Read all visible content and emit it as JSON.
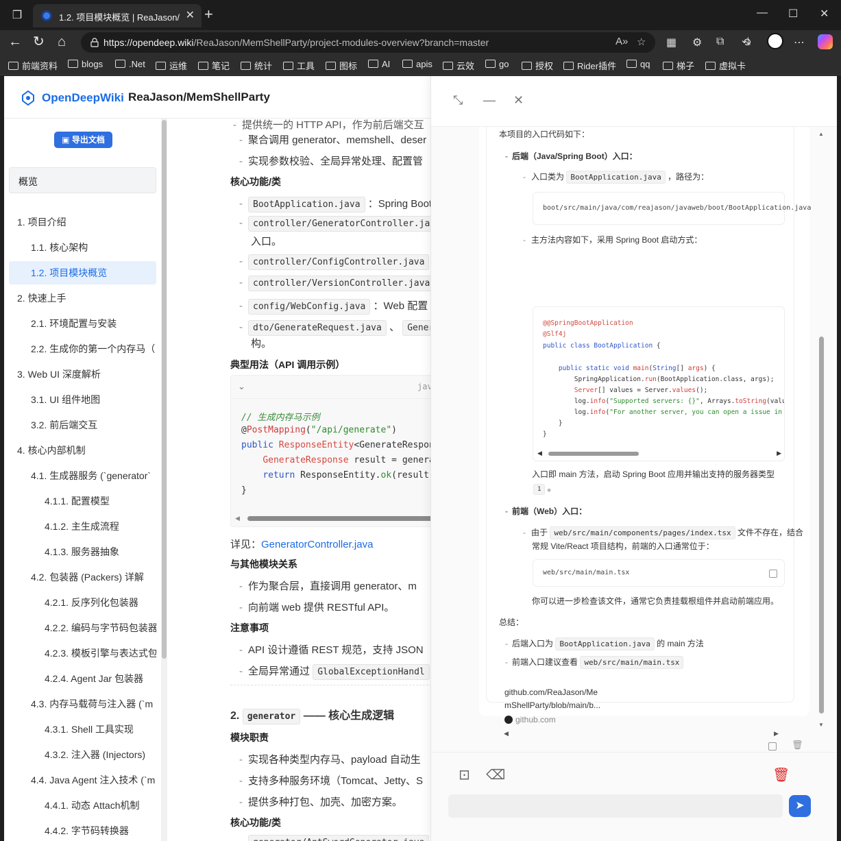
{
  "browser": {
    "tab_title": "1.2. 项目模块概览 | ReaJason/MemShellParty",
    "url_host": "https://opendeep.wiki",
    "url_path": "/ReaJason/MemShellParty/project-modules-overview?branch=master",
    "bookmarks": [
      "前端资料",
      "blogs",
      ".Net",
      "运维",
      "笔记",
      "统计",
      "工具",
      "图标",
      "AI",
      "apis",
      "云效",
      "go",
      "授权",
      "Rider插件",
      "qq",
      "梯子",
      "虚拟卡"
    ]
  },
  "site": {
    "brand": "OpenDeepWiki",
    "repo": "ReaJason/MemShellParty"
  },
  "sidebar": {
    "export_label": "导出文档",
    "overview_label": "概览",
    "items": [
      {
        "label": "1. 项目介绍",
        "level": 0,
        "active": false
      },
      {
        "label": "1.1. 核心架构",
        "level": 1,
        "active": false
      },
      {
        "label": "1.2. 项目模块概览",
        "level": 1,
        "active": true
      },
      {
        "label": "2. 快速上手",
        "level": 0,
        "active": false
      },
      {
        "label": "2.1. 环境配置与安装",
        "level": 1,
        "active": false
      },
      {
        "label": "2.2. 生成你的第一个内存马（",
        "level": 1,
        "active": false
      },
      {
        "label": "3. Web UI 深度解析",
        "level": 0,
        "active": false
      },
      {
        "label": "3.1. UI 组件地图",
        "level": 1,
        "active": false
      },
      {
        "label": "3.2. 前后端交互",
        "level": 1,
        "active": false
      },
      {
        "label": "4. 核心内部机制",
        "level": 0,
        "active": false
      },
      {
        "label": "4.1. 生成器服务 (`generator`",
        "level": 1,
        "active": false
      },
      {
        "label": "4.1.1. 配置模型",
        "level": 2,
        "active": false
      },
      {
        "label": "4.1.2. 主生成流程",
        "level": 2,
        "active": false
      },
      {
        "label": "4.1.3. 服务器抽象",
        "level": 2,
        "active": false
      },
      {
        "label": "4.2. 包装器 (Packers) 详解",
        "level": 1,
        "active": false
      },
      {
        "label": "4.2.1. 反序列化包装器",
        "level": 2,
        "active": false
      },
      {
        "label": "4.2.2. 编码与字节码包装器",
        "level": 2,
        "active": false
      },
      {
        "label": "4.2.3. 模板引擎与表达式包",
        "level": 2,
        "active": false
      },
      {
        "label": "4.2.4. Agent Jar 包装器",
        "level": 2,
        "active": false
      },
      {
        "label": "4.3. 内存马载荷与注入器 (`m",
        "level": 1,
        "active": false
      },
      {
        "label": "4.3.1. Shell 工具实现",
        "level": 2,
        "active": false
      },
      {
        "label": "4.3.2. 注入器 (Injectors)",
        "level": 2,
        "active": false
      },
      {
        "label": "4.4. Java Agent 注入技术 (`m",
        "level": 1,
        "active": false
      },
      {
        "label": "4.4.1. 动态 Attach机制",
        "level": 2,
        "active": false
      },
      {
        "label": "4.4.2. 字节码转换器",
        "level": 2,
        "active": false
      }
    ]
  },
  "doc": {
    "line_top": "提供统一的 HTTP API，作为前后端交互",
    "resp1": "聚合调用 generator、memshell、deser",
    "resp2": "实现参数校验、全局异常处理、配置管",
    "h_core": "核心功能/类",
    "c1_code": "BootApplication.java",
    "c1_text": "：Spring Boot",
    "c2_code": "controller/GeneratorController.java",
    "c2_cont": "入口。",
    "c3_code": "controller/ConfigController.java",
    "c4_code": "controller/VersionController.java",
    "c5_code": "config/WebConfig.java",
    "c5_text": "：Web 配置",
    "c6_code": "dto/GenerateRequest.java",
    "c6_sep": "、",
    "c6_code2": "Generat",
    "c6_cont": "构。",
    "h_usage": "典型用法（API 调用示例）",
    "code_lang": "java",
    "code_lines": [
      "// 生成内存马示例",
      "@PostMapping(\"/api/generate\")",
      "public ResponseEntity<GenerateRespon",
      "    GenerateResponse result = genera",
      "    return ResponseEntity.ok(result)",
      "}"
    ],
    "detail_prefix": "详见：",
    "detail_link": "GeneratorController.java",
    "h_relation": "与其他模块关系",
    "rel1": "作为聚合层，直接调用 generator、m",
    "rel2": "向前端 web 提供 RESTful API。",
    "h_notes": "注意事项",
    "note1": "API 设计遵循 REST 规范，支持 JSON",
    "note2_prefix": "全局异常通过",
    "note2_code": "GlobalExceptionHandl",
    "sec2_num": "2.",
    "sec2_code": "generator",
    "sec2_title": "—— 核心生成逻辑",
    "h_resp": "模块职责",
    "g1": "实现各种类型内存马、payload 自动生",
    "g2": "支持多种服务环境（Tomcat、Jetty、S",
    "g3": "提供多种打包、加壳、加密方案。",
    "h_core2": "核心功能/类",
    "g_code": "generator/AntSwordGenerator.java"
  },
  "chat": {
    "intro": "本项目的入口代码如下：",
    "backend_h": "后端（Java/Spring Boot）入口：",
    "be1_prefix": "入口类为",
    "be1_code": "BootApplication.java",
    "be1_suffix": "，路径为：",
    "be_path": "boot/src/main/java/com/reajason/javaweb/boot/BootApplication.java",
    "be2": "主方法内容如下，采用 Spring Boot 启动方式：",
    "java_lines": [
      "@SpringBootApplication",
      "@Slf4j",
      "public class BootApplication {",
      "",
      "    public static void main(String[] args) {",
      "        SpringApplication.run(BootApplication.class, args);",
      "        Server[] values = Server.values();",
      "        log.info(\"Supported servers: {}\", Arrays.toString(values));",
      "        log.info(\"For another server, you can open a issue in GitHub,",
      "    }",
      "}"
    ],
    "be3_line1": "入口即 main 方法，启动 Spring Boot 应用并输出支持的服务器类型",
    "be3_ref": "1",
    "be3_end": "。",
    "frontend_h": "前端（Web）入口：",
    "fe1_prefix": "由于",
    "fe1_code": "web/src/main/components/pages/index.tsx",
    "fe1_suffix": "文件不存在，结合",
    "fe1_line2": "常规 Vite/React 项目结构，前端的入口通常位于：",
    "fe_path": "web/src/main/main.tsx",
    "fe2": "你可以进一步检查该文件，通常它负责挂载根组件并启动前端应用。",
    "summary": "总结：",
    "sum1_prefix": "后端入口为",
    "sum1_code": "BootApplication.java",
    "sum1_suffix": "的 main 方法",
    "sum2_prefix": "前端入口建议查看",
    "sum2_code": "web/src/main/main.tsx",
    "link_line1": "github.com/ReaJason/Me",
    "link_line2": "mShellParty/blob/main/b...",
    "link_host": "github.com"
  }
}
